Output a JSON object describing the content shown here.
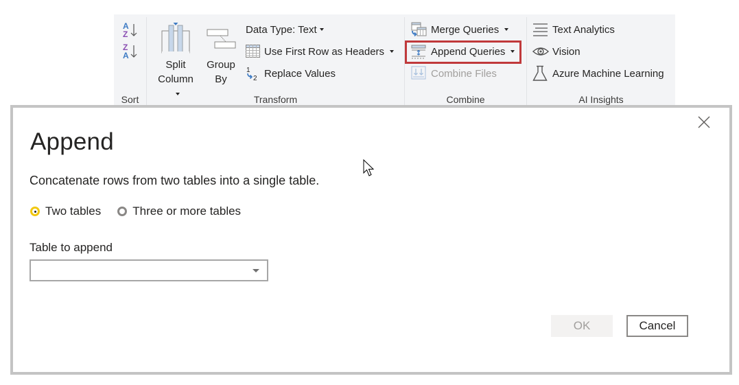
{
  "ribbon": {
    "groups": {
      "sort": {
        "label": "Sort",
        "buttons": [
          {
            "name": "sort-ascending",
            "icon": "sort-az-icon"
          },
          {
            "name": "sort-descending",
            "icon": "sort-za-icon"
          }
        ]
      },
      "transform": {
        "label": "Transform",
        "split_column": {
          "line1": "Split",
          "line2": "Column"
        },
        "group_by": {
          "line1": "Group",
          "line2": "By"
        },
        "data_type": "Data Type: Text",
        "use_first_row": "Use First Row as Headers",
        "replace_values": "Replace Values"
      },
      "combine": {
        "label": "Combine",
        "merge_queries": "Merge Queries",
        "append_queries": "Append Queries",
        "combine_files": "Combine Files"
      },
      "ai_insights": {
        "label": "AI Insights",
        "text_analytics": "Text Analytics",
        "vision": "Vision",
        "azure_ml": "Azure Machine Learning"
      }
    },
    "highlight_color": "#c0393b"
  },
  "dialog": {
    "title": "Append",
    "description": "Concatenate rows from two tables into a single table.",
    "radio_options": [
      {
        "label": "Two tables",
        "selected": true
      },
      {
        "label": "Three or more tables",
        "selected": false
      }
    ],
    "table_to_append_label": "Table to append",
    "table_to_append_value": "",
    "ok_label": "OK",
    "cancel_label": "Cancel",
    "accent_color": "#f2c811"
  }
}
